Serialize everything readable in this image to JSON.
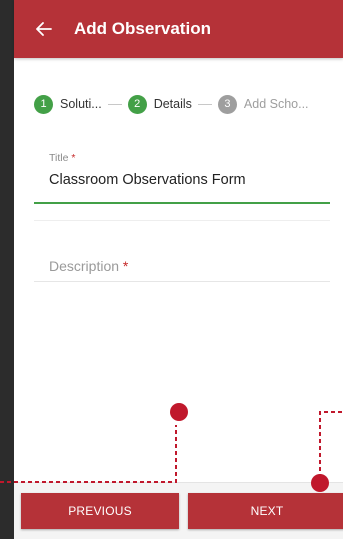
{
  "app_bar": {
    "title": "Add Observation",
    "back_icon": "arrow-left-icon"
  },
  "stepper": {
    "steps": [
      {
        "number": "1",
        "label": "Soluti...",
        "state": "done"
      },
      {
        "number": "2",
        "label": "Details",
        "state": "done"
      },
      {
        "number": "3",
        "label": "Add Scho...",
        "state": "todo"
      }
    ]
  },
  "form": {
    "title_field": {
      "label": "Title",
      "required_mark": "*",
      "value": "Classroom Observations Form"
    },
    "description_field": {
      "placeholder": "Description",
      "required_mark": "*"
    }
  },
  "buttons": {
    "previous": "PREVIOUS",
    "next": "NEXT"
  },
  "colors": {
    "primary": "#b53238",
    "step_done": "#43a047",
    "step_todo": "#9e9e9e",
    "annotation": "#c0182c"
  }
}
